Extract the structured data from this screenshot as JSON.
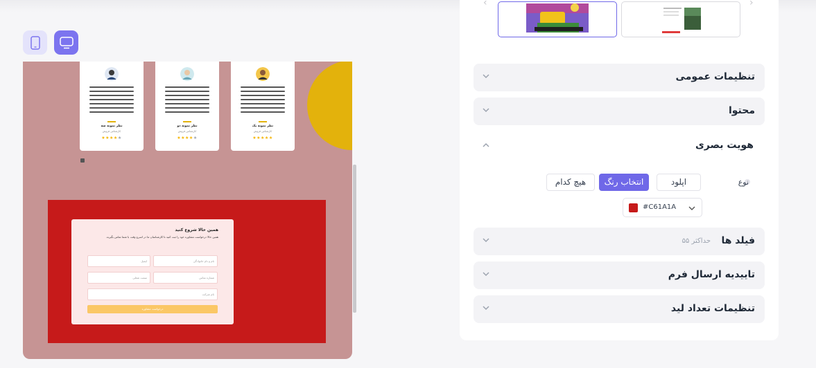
{
  "preview": {
    "testimonials": [
      {
        "name": "نظر نمونه سه",
        "role": "کارشناس فروش",
        "stars": 4
      },
      {
        "name": "نظر نمونه دو",
        "role": "کارشناس فروش",
        "stars": 4
      },
      {
        "name": "نظر نمونه یک",
        "role": "کارشناس فروش",
        "stars": 5
      }
    ],
    "form": {
      "title": "همین حالا شروع کنید",
      "subtitle": "همین حالا درخواست مشاوره خود را ثبت کنید تا کارشناسان ما در اسرع وقت با شما تماس بگیرند.",
      "fields": [
        "نام و نام خانوادگی",
        "ایمیل",
        "شماره تماس",
        "سمت شغلی",
        "نام شرکت"
      ],
      "submit": "درخواست مشاوره"
    },
    "colors": {
      "background": "#c69494",
      "accent": "#e3b20c",
      "cta": "#c61a1a"
    }
  },
  "panel": {
    "sections": {
      "general": "تنظیمات عمومی",
      "content": "محتوا",
      "visual": "هویت بصری",
      "fields": "فیلد ها",
      "fields_note": "حداکثر ۵۵",
      "confirm": "تاییدیه ارسال فرم",
      "lead": "تنظیمات تعداد لید"
    },
    "type_label": "نوع",
    "options": {
      "upload": "اپلود",
      "pick_color": "انتخاب رنگ",
      "none": "هیچ کدام"
    },
    "selected_option": "انتخاب رنگ",
    "color_value": "#C61A1A"
  }
}
